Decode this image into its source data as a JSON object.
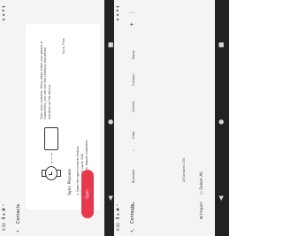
{
  "left_screen": {
    "status": {
      "time": "9:30",
      "icons": "▐ ▲ ■ •",
      "right": "◉ ◆ ▼ ▮"
    },
    "title": "Contacts",
    "description": "Sync your contacts. Many steps when your phone is connected, you can see the contacts and phone numbers on the device.",
    "sync_flow": "Sync Flow",
    "sync_process_title": "Sync Process",
    "steps": [
      "1. Open the app's contacts feature.",
      "2. Select contacts (up to 100).",
      "3. Confirm selection, import completed."
    ],
    "open_button": "Open"
  },
  "right_screen": {
    "status": {
      "time": "9:30",
      "icons": "▐ ▲ ■ •",
      "right": "◉ ◆ ▼ ▮"
    },
    "title": "Contacts",
    "index_a": "A",
    "index_c": "C",
    "contacts": [
      {
        "name": "Alice",
        "selected": true
      },
      {
        "name": "Brandon",
        "selected": true
      },
      {
        "name": "Cate",
        "selected": false
      },
      {
        "name": "Camila",
        "selected": false
      },
      {
        "name": "Carolyn",
        "selected": false
      },
      {
        "name": "Daisy",
        "selected": false
      }
    ],
    "selected_count": "2/Contacts 100",
    "import_label": "Import",
    "select_all_label": "Select All"
  },
  "nav": {
    "back": "◀",
    "home": "●",
    "recent": "■"
  },
  "colors": {
    "accent": "#e8384f",
    "toggle_on": "#f0604d",
    "toggle_off": "#d4d4d4",
    "navbar": "#222222"
  }
}
